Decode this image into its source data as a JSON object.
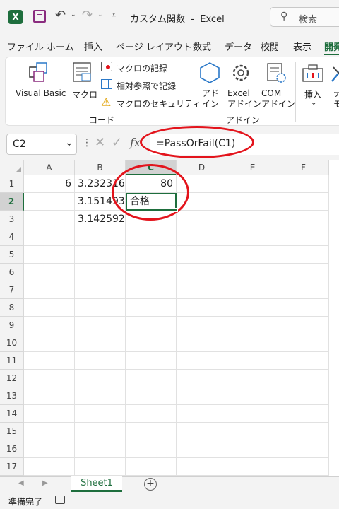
{
  "window": {
    "doc_title": "カスタム関数",
    "separator": "-",
    "app_name": "Excel",
    "search_placeholder": "検索"
  },
  "menu": [
    "ファイル",
    "ホーム",
    "挿入",
    "ページ レイアウト",
    "数式",
    "データ",
    "校閲",
    "表示",
    "開発"
  ],
  "ribbon": {
    "code": {
      "visual_basic": "Visual Basic",
      "macro": "マクロ",
      "record_macro": "マクロの記録",
      "relative_ref": "相対参照で記録",
      "macro_security": "マクロのセキュリティ",
      "group_label": "コード"
    },
    "addins": {
      "addin": "アド\nイン",
      "excel_addin": "Excel\nアドイン",
      "com_addin": "COM\nアドイン",
      "group_label": "アドイン"
    },
    "insert": "挿入",
    "design_mode": "デザ\nモ"
  },
  "formula_bar": {
    "name_box": "C2",
    "formula": "=PassOrFail(C1)",
    "fx": "fx"
  },
  "grid": {
    "columns": [
      "A",
      "B",
      "C",
      "D",
      "E",
      "F"
    ],
    "rows": [
      "1",
      "2",
      "3",
      "4",
      "5",
      "6",
      "7",
      "8",
      "9",
      "10",
      "11",
      "12",
      "13",
      "14",
      "15",
      "16",
      "17"
    ],
    "cells": {
      "A1": "6",
      "B1": "3.232316",
      "C1": "80",
      "B2": "3.151493",
      "C2": "合格",
      "B3": "3.142592"
    },
    "selected_cell": "C2"
  },
  "sheets": {
    "active": "Sheet1",
    "add": "+"
  },
  "status": {
    "ready": "準備完了"
  },
  "colors": {
    "accent": "#1e6e3d",
    "annotation": "#e3141c"
  }
}
